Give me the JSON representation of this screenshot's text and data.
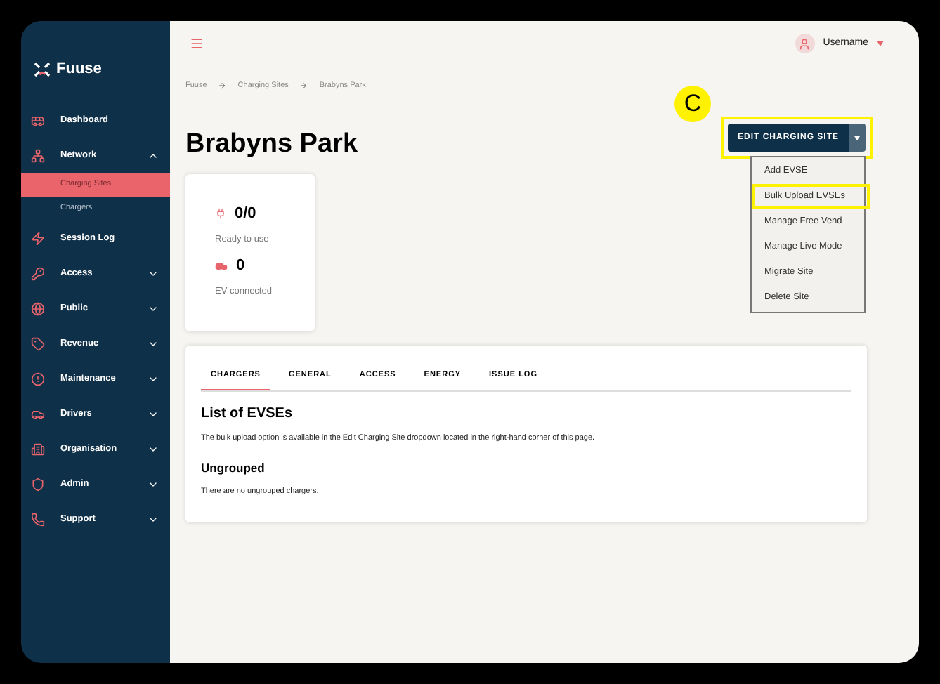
{
  "brand": "Fuuse",
  "sidebar": {
    "items": [
      {
        "label": "Dashboard"
      },
      {
        "label": "Network",
        "expanded": true,
        "children": [
          {
            "label": "Charging Sites",
            "selected": true
          },
          {
            "label": "Chargers",
            "selected": false
          }
        ]
      },
      {
        "label": "Session Log"
      },
      {
        "label": "Access",
        "expanded": false
      },
      {
        "label": "Public",
        "expanded": false
      },
      {
        "label": "Revenue",
        "expanded": false
      },
      {
        "label": "Maintenance",
        "expanded": false
      },
      {
        "label": "Drivers",
        "expanded": false
      },
      {
        "label": "Organisation",
        "expanded": false
      },
      {
        "label": "Admin",
        "expanded": false
      },
      {
        "label": "Support",
        "expanded": false
      }
    ]
  },
  "header": {
    "username": "Username"
  },
  "breadcrumb": [
    "Fuuse",
    "Charging Sites",
    "Brabyns Park"
  ],
  "title": "Brabyns Park",
  "stats": [
    {
      "value": "0/0",
      "label": "Ready to use"
    },
    {
      "value": "0",
      "label": "EV connected"
    }
  ],
  "edit_button": {
    "label": "EDIT CHARGING SITE",
    "highlighted": true
  },
  "annotation": {
    "label": "C"
  },
  "menu": [
    {
      "label": "Add EVSE",
      "highlighted": false
    },
    {
      "label": "Bulk Upload EVSEs",
      "highlighted": true
    },
    {
      "label": "Manage Free Vend",
      "highlighted": false
    },
    {
      "label": "Manage Live Mode",
      "highlighted": false
    },
    {
      "label": "Migrate Site",
      "highlighted": false
    },
    {
      "label": "Delete Site",
      "highlighted": false
    }
  ],
  "tabs": [
    {
      "label": "CHARGERS",
      "selected": true
    },
    {
      "label": "GENERAL",
      "selected": false
    },
    {
      "label": "ACCESS",
      "selected": false
    },
    {
      "label": "ENERGY",
      "selected": false
    },
    {
      "label": "ISSUE LOG",
      "selected": false
    }
  ],
  "content": {
    "heading": "List of EVSEs",
    "text": "The bulk upload option is available in the Edit Charging Site dropdown located in the right-hand corner of this page.",
    "subheading": "Ungrouped",
    "subtext": "There are no ungrouped chargers."
  }
}
